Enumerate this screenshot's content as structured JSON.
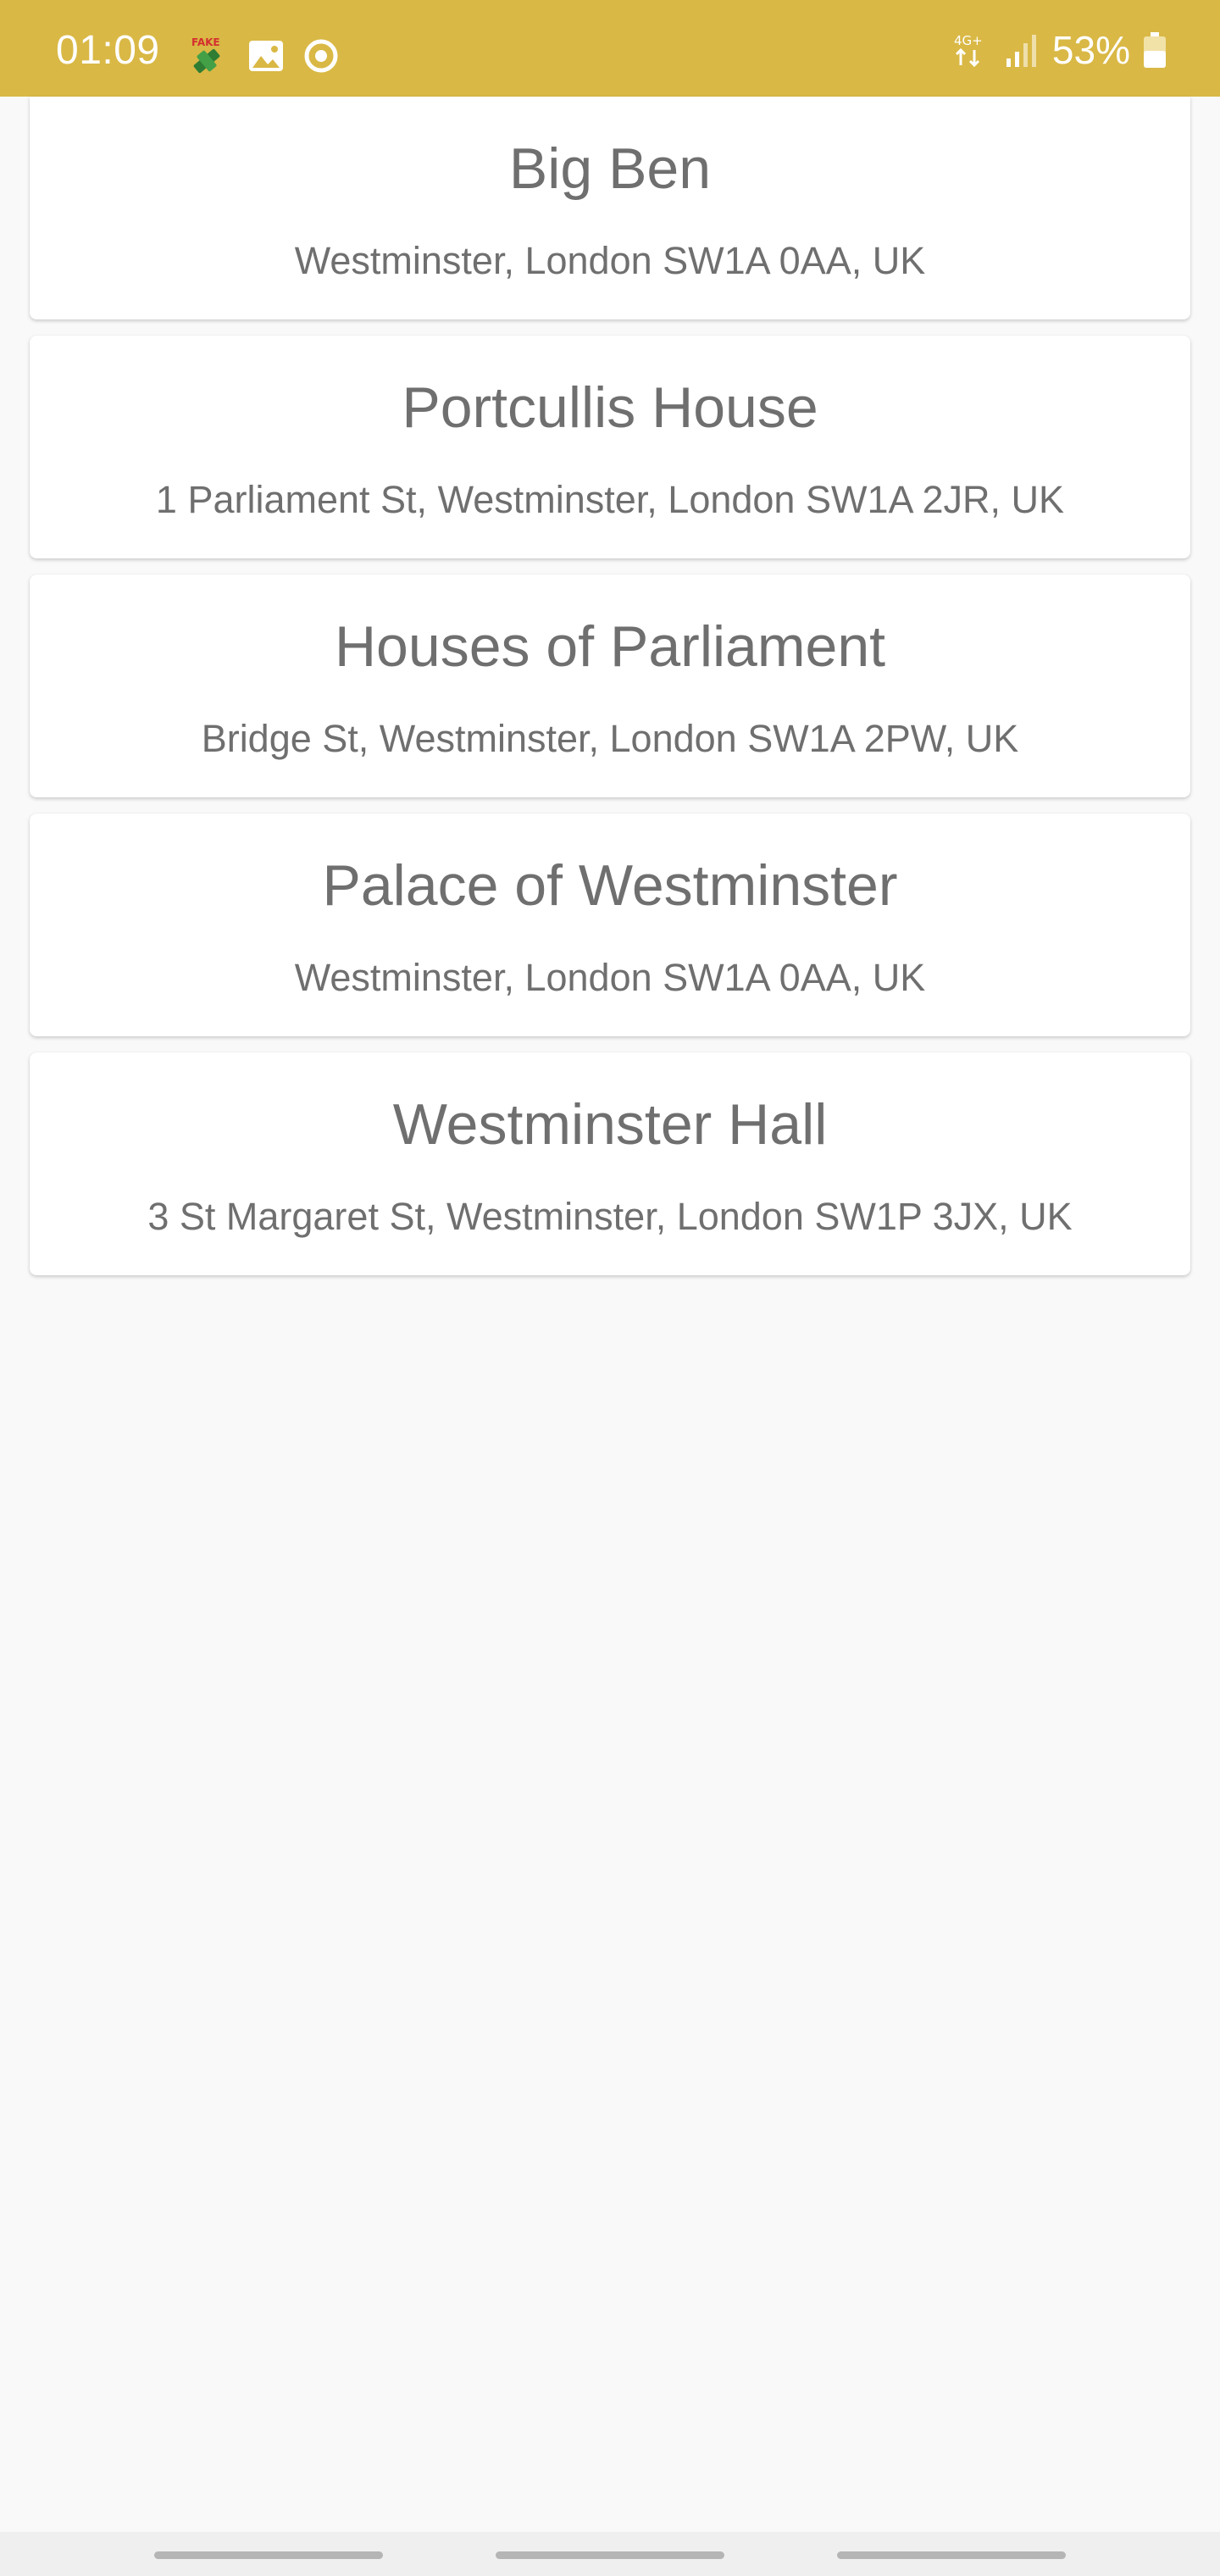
{
  "status_bar": {
    "time": "01:09",
    "left_icons": [
      "fake-gps-icon",
      "image-icon",
      "record-icon"
    ],
    "network": "4G+",
    "battery": "53%",
    "background_color": "#d9b845"
  },
  "places": [
    {
      "name": "Big Ben",
      "address": "Westminster, London SW1A 0AA, UK"
    },
    {
      "name": "Portcullis House",
      "address": "1 Parliament St, Westminster, London SW1A 2JR, UK"
    },
    {
      "name": "Houses of Parliament",
      "address": "Bridge St, Westminster, London SW1A 2PW, UK"
    },
    {
      "name": "Palace of Westminster",
      "address": "Westminster, London SW1A 0AA, UK"
    },
    {
      "name": "Westminster Hall",
      "address": "3 St Margaret St, Westminster, London SW1P 3JX, UK"
    }
  ],
  "nav_bar": {
    "buttons": [
      "recents-button",
      "home-button",
      "back-button"
    ]
  }
}
